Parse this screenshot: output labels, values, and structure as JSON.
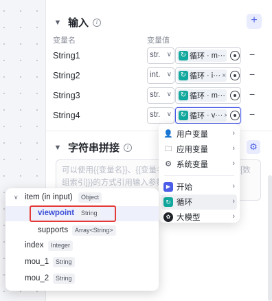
{
  "input_section": {
    "title": "输入",
    "col_name": "变量名",
    "col_value": "变量值",
    "add_label": "+",
    "rows": [
      {
        "name": "String1",
        "type": "str.",
        "ref_node": "循环",
        "ref_var": "m···"
      },
      {
        "name": "String2",
        "type": "int.",
        "ref_node": "循环",
        "ref_var": "i···"
      },
      {
        "name": "String3",
        "type": "str.",
        "ref_node": "循环",
        "ref_var": "m···"
      },
      {
        "name": "String4",
        "type": "str.",
        "ref_node": "循环",
        "ref_var": "v···"
      }
    ]
  },
  "concat_section": {
    "title": "字符串拼接",
    "placeholder": "可以使用{{变量名}}、{{变量名.子变量名}}、{{变量名[数组索引]}}的方式引用输入参数中的变量"
  },
  "node_menu": {
    "items": [
      {
        "label": "用户变量",
        "icon": "user-icon"
      },
      {
        "label": "应用变量",
        "icon": "folder-icon"
      },
      {
        "label": "系统变量",
        "icon": "gear-icon"
      },
      {
        "label": "开始",
        "icon": "start-node-icon"
      },
      {
        "label": "循环",
        "icon": "loop-node-icon"
      },
      {
        "label": "大模型",
        "icon": "llm-node-icon"
      }
    ]
  },
  "var_tree": {
    "items": [
      {
        "label": "item (in input)",
        "badge": "Object"
      },
      {
        "label": "viewpoint",
        "badge": "String"
      },
      {
        "label": "supports",
        "badge": "Array<String>"
      },
      {
        "label": "index",
        "badge": "Integer"
      },
      {
        "label": "mou_1",
        "badge": "String"
      },
      {
        "label": "mou_2",
        "badge": "String"
      }
    ]
  },
  "colors": {
    "accent": "#4c5ee8",
    "loop": "#12a89d",
    "highlight": "#e53935"
  }
}
